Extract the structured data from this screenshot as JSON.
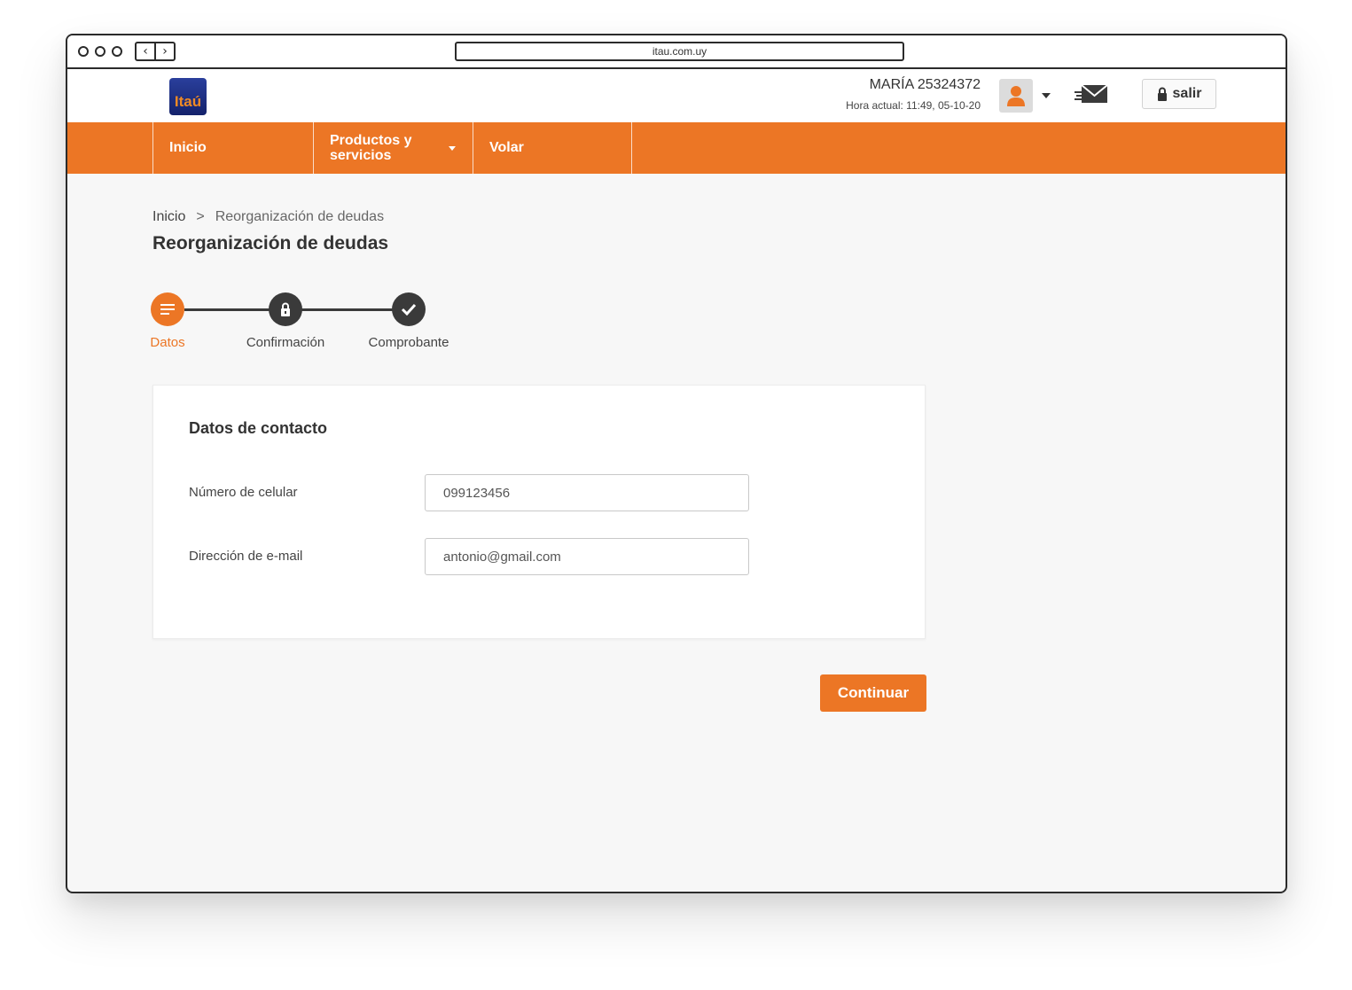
{
  "browser": {
    "url": "itau.com.uy"
  },
  "header": {
    "logo_text": "Itaú",
    "user_name": "MARÍA 25324372",
    "current_time": "Hora actual: 11:49, 05-10-20",
    "logout_label": "salir"
  },
  "nav": {
    "items": [
      {
        "label": "Inicio"
      },
      {
        "label": "Productos y servicios"
      },
      {
        "label": "Volar"
      }
    ]
  },
  "breadcrumb": {
    "home": "Inicio",
    "separator": ">",
    "current": "Reorganización de deudas"
  },
  "page": {
    "title": "Reorganización de deudas"
  },
  "stepper": {
    "steps": [
      {
        "label": "Datos",
        "state": "active",
        "icon": "list-icon"
      },
      {
        "label": "Confirmación",
        "state": "pending",
        "icon": "lock-icon"
      },
      {
        "label": "Comprobante",
        "state": "pending",
        "icon": "check-icon"
      }
    ]
  },
  "form": {
    "title": "Datos de contacto",
    "phone": {
      "label": "Número de celular",
      "value": "099123456"
    },
    "email": {
      "label": "Dirección de e-mail",
      "value": "antonio@gmail.com"
    }
  },
  "actions": {
    "continue_label": "Continuar"
  },
  "colors": {
    "brand_orange": "#ec7625",
    "brand_blue": "#1f2f86",
    "step_dark": "#3a3a3a"
  }
}
